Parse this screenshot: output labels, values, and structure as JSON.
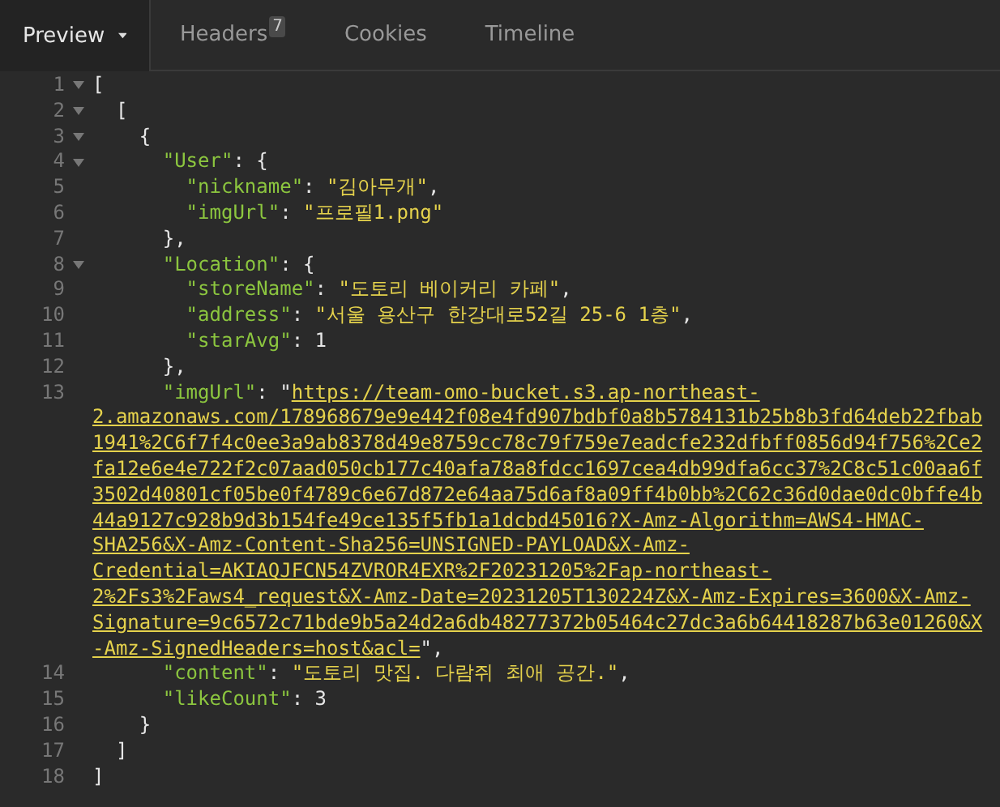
{
  "tabs": [
    {
      "label": "Preview",
      "selected": true,
      "dropdown": true
    },
    {
      "label": "Headers",
      "selected": false,
      "badge": "7"
    },
    {
      "label": "Cookies",
      "selected": false
    },
    {
      "label": "Timeline",
      "selected": false
    }
  ],
  "code_lines": [
    {
      "number": "1",
      "expanded": true,
      "tokens": [
        {
          "kind": "punct",
          "text": "["
        }
      ]
    },
    {
      "number": "2",
      "expanded": true,
      "tokens": [
        {
          "kind": "punct",
          "text": "  ["
        }
      ]
    },
    {
      "number": "3",
      "expanded": true,
      "tokens": [
        {
          "kind": "punct",
          "text": "    {"
        }
      ]
    },
    {
      "number": "4",
      "expanded": true,
      "tokens": [
        {
          "kind": "key",
          "text": "      \"User\""
        },
        {
          "kind": "punct",
          "text": ": {"
        }
      ]
    },
    {
      "number": "5",
      "tokens": [
        {
          "kind": "key",
          "text": "        \"nickname\""
        },
        {
          "kind": "punct",
          "text": ": "
        },
        {
          "kind": "string",
          "text": "\"김아무개\""
        },
        {
          "kind": "punct",
          "text": ","
        }
      ]
    },
    {
      "number": "6",
      "tokens": [
        {
          "kind": "key",
          "text": "        \"imgUrl\""
        },
        {
          "kind": "punct",
          "text": ": "
        },
        {
          "kind": "string",
          "text": "\"프로필1.png\""
        }
      ]
    },
    {
      "number": "7",
      "tokens": [
        {
          "kind": "punct",
          "text": "      },"
        }
      ]
    },
    {
      "number": "8",
      "expanded": true,
      "tokens": [
        {
          "kind": "key",
          "text": "      \"Location\""
        },
        {
          "kind": "punct",
          "text": ": {"
        }
      ]
    },
    {
      "number": "9",
      "tokens": [
        {
          "kind": "key",
          "text": "        \"storeName\""
        },
        {
          "kind": "punct",
          "text": ": "
        },
        {
          "kind": "string",
          "text": "\"도토리 베이커리 카페\""
        },
        {
          "kind": "punct",
          "text": ","
        }
      ]
    },
    {
      "number": "10",
      "tokens": [
        {
          "kind": "key",
          "text": "        \"address\""
        },
        {
          "kind": "punct",
          "text": ": "
        },
        {
          "kind": "string",
          "text": "\"서울 용산구 한강대로52길 25-6 1층\""
        },
        {
          "kind": "punct",
          "text": ","
        }
      ]
    },
    {
      "number": "11",
      "tokens": [
        {
          "kind": "key",
          "text": "        \"starAvg\""
        },
        {
          "kind": "punct",
          "text": ": "
        },
        {
          "kind": "number",
          "text": "1"
        }
      ]
    },
    {
      "number": "12",
      "tokens": [
        {
          "kind": "punct",
          "text": "      },"
        }
      ]
    },
    {
      "number": "13",
      "tokens": [
        {
          "kind": "key",
          "text": "      \"imgUrl\""
        },
        {
          "kind": "punct",
          "text": ": \""
        },
        {
          "kind": "link",
          "text": "https://team-omo-bucket.s3.ap-northeast-2.amazonaws.com/178968679e9e442f08e4fd907bdbf0a8b5784131b25b8b3fd64deb22fbab1941%2C6f7f4c0ee3a9ab8378d49e8759cc78c79f759e7eadcfe232dfbff0856d94f756%2Ce2fa12e6e4e722f2c07aad050cb177c40afa78a8fdcc1697cea4db99dfa6cc37%2C8c51c00aa6f3502d40801cf05be0f4789c6e67d872e64aa75d6af8a09ff4b0bb%2C62c36d0dae0dc0bffe4b44a9127c928b9d3b154fe49ce135f5fb1a1dcbd45016?X-Amz-Algorithm=AWS4-HMAC-SHA256&X-Amz-Content-Sha256=UNSIGNED-PAYLOAD&X-Amz-Credential=AKIAQJFCN54ZVROR4EXR%2F20231205%2Fap-northeast-2%2Fs3%2Faws4_request&X-Amz-Date=20231205T130224Z&X-Amz-Expires=3600&X-Amz-Signature=9c6572c71bde9b5a24d2a6db48277372b05464c27dc3a6b64418287b63e01260&X-Amz-SignedHeaders=host&acl="
        },
        {
          "kind": "punct",
          "text": "\","
        }
      ]
    },
    {
      "number": "14",
      "tokens": [
        {
          "kind": "key",
          "text": "      \"content\""
        },
        {
          "kind": "punct",
          "text": ": "
        },
        {
          "kind": "string",
          "text": "\"도토리 맛집. 다람쥐 최애 공간.\""
        },
        {
          "kind": "punct",
          "text": ","
        }
      ]
    },
    {
      "number": "15",
      "tokens": [
        {
          "kind": "key",
          "text": "      \"likeCount\""
        },
        {
          "kind": "punct",
          "text": ": "
        },
        {
          "kind": "number",
          "text": "3"
        }
      ]
    },
    {
      "number": "16",
      "tokens": [
        {
          "kind": "punct",
          "text": "    }"
        }
      ]
    },
    {
      "number": "17",
      "tokens": [
        {
          "kind": "punct",
          "text": "  ]"
        }
      ]
    },
    {
      "number": "18",
      "tokens": [
        {
          "kind": "punct",
          "text": "]"
        }
      ]
    }
  ]
}
